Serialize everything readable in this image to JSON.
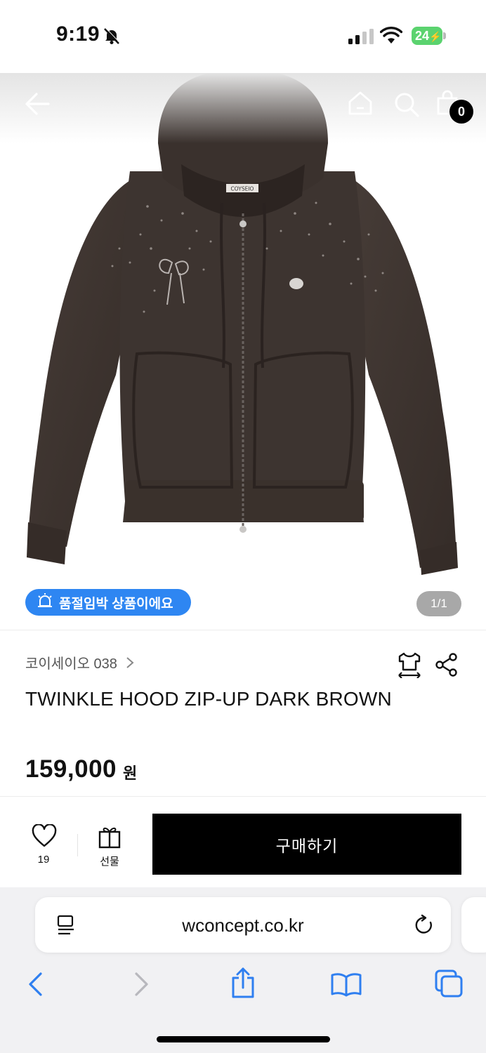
{
  "status_bar": {
    "time": "9:19",
    "battery": "24"
  },
  "header": {
    "cart_count": "0"
  },
  "product": {
    "soldout_notice": "품절임박 상품이에요",
    "image_page": "1/1",
    "brand": "코이세이오 038",
    "name": "TWINKLE HOOD ZIP-UP DARK BROWN",
    "price": "159,000",
    "currency": "원",
    "hood_tag": "COYSEIO"
  },
  "action_bar": {
    "like_count": "19",
    "gift_label": "선물",
    "buy_label": "구매하기"
  },
  "browser": {
    "url": "wconcept.co.kr"
  },
  "colors": {
    "garment": "#3d3430",
    "accent_blue": "#2e86f2",
    "safari_blue": "#2f7ff0"
  }
}
